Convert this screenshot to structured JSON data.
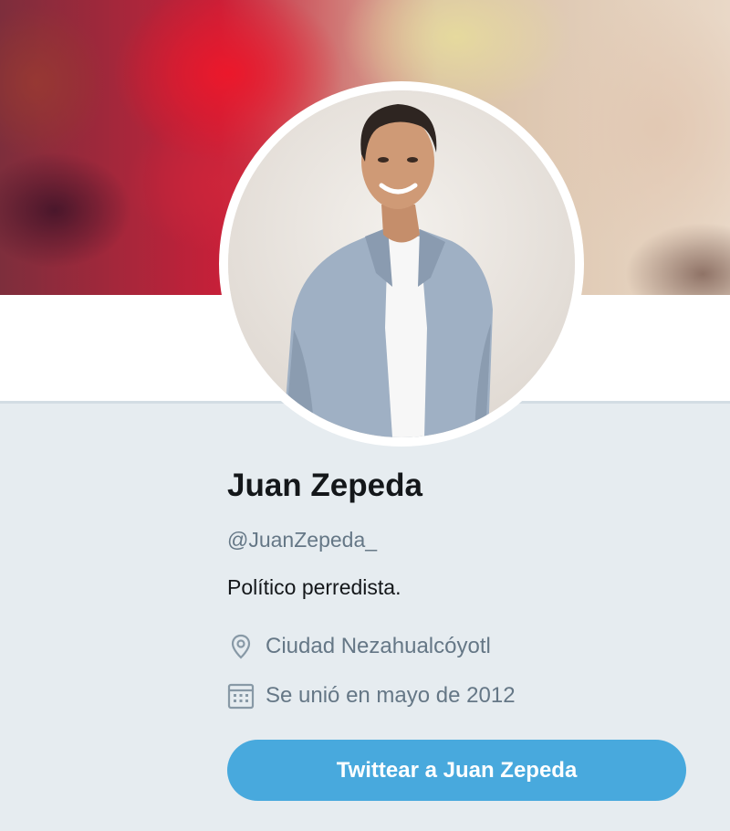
{
  "profile": {
    "name": "Juan Zepeda",
    "handle": "@JuanZepeda_",
    "bio": "Político perredista.",
    "location": "Ciudad Nezahualcóyotl",
    "joined": "Se unió en mayo de 2012"
  },
  "actions": {
    "tweet_to_label": "Twittear a Juan Zepeda"
  },
  "icons": {
    "location": "map-pin-icon",
    "joined": "calendar-icon"
  },
  "colors": {
    "accent": "#48a9dd",
    "name_text": "#14171a",
    "secondary_text": "#657786",
    "page_background": "#e6ecf0"
  }
}
